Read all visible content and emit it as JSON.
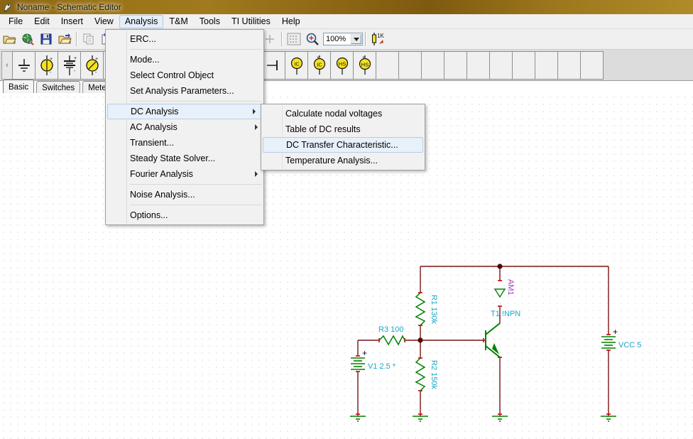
{
  "window": {
    "title": "Noname - Schematic Editor",
    "icon": "app-icon"
  },
  "menubar": {
    "items": [
      {
        "label": "File",
        "active": false
      },
      {
        "label": "Edit",
        "active": false
      },
      {
        "label": "Insert",
        "active": false
      },
      {
        "label": "View",
        "active": false
      },
      {
        "label": "Analysis",
        "active": true
      },
      {
        "label": "T&M",
        "active": false
      },
      {
        "label": "Tools",
        "active": false
      },
      {
        "label": "TI Utilities",
        "active": false
      },
      {
        "label": "Help",
        "active": false
      }
    ]
  },
  "toolbar": {
    "zoom_value": "100%",
    "buttons": [
      {
        "name": "open-button",
        "icon": "folder-open-icon"
      },
      {
        "name": "browse-button",
        "icon": "globe-search-icon"
      },
      {
        "name": "save-button",
        "icon": "floppy-save-icon"
      },
      {
        "name": "save-as-button",
        "icon": "folder-arrow-icon"
      },
      {
        "name": "copy-button",
        "icon": "copy-icon"
      },
      {
        "name": "paste-button",
        "icon": "paste-icon"
      },
      {
        "name": "cursor-button",
        "icon": "crosshair-icon"
      },
      {
        "name": "grid-button",
        "icon": "grid-icon"
      },
      {
        "name": "zoom-in-button",
        "icon": "magnifier-plus-icon"
      },
      {
        "name": "resistor-value-button",
        "icon": "resistor-1k-icon"
      }
    ]
  },
  "palette": {
    "scroll_left_label": "‹",
    "tabs": [
      {
        "label": "Basic",
        "selected": true
      },
      {
        "label": "Switches",
        "selected": false
      },
      {
        "label": "Meters",
        "selected": false
      }
    ],
    "cells": [
      {
        "name": "ground-symbol",
        "icon": "ground-icon"
      },
      {
        "name": "dc-source-symbol",
        "icon": "dc-source-icon"
      },
      {
        "name": "battery-symbol",
        "icon": "battery-icon"
      },
      {
        "name": "ac-source-symbol",
        "icon": "ac-source-icon"
      },
      {
        "name": "resistor-symbol",
        "icon": "resistor-icon"
      },
      {
        "name": "capacitor-symbol",
        "icon": "capacitor-icon"
      },
      {
        "name": "inductor-symbol",
        "icon": "inductor-icon"
      },
      {
        "name": "coupled-inductor-symbol",
        "icon": "coupled-inductor-icon"
      },
      {
        "name": "transformer-symbol",
        "icon": "transformer-icon"
      },
      {
        "name": "switch-symbol",
        "icon": "switch-icon"
      },
      {
        "name": "potentiometer-symbol",
        "icon": "potentiometer-icon"
      },
      {
        "name": "terminal-symbol",
        "icon": "terminal-icon"
      },
      {
        "name": "ic-symbol",
        "icon": "ic-icon"
      },
      {
        "name": "ic-plus-symbol",
        "icon": "ic-plus-icon"
      },
      {
        "name": "hs-symbol",
        "icon": "hs-icon"
      },
      {
        "name": "hs-plus-symbol",
        "icon": "hs-plus-icon"
      }
    ],
    "empty_cells": 10
  },
  "analysis_menu": {
    "items": [
      {
        "label": "ERC...",
        "submenu": false,
        "highlighted": false,
        "separator_after": true
      },
      {
        "label": "Mode...",
        "submenu": false,
        "highlighted": false,
        "separator_after": false
      },
      {
        "label": "Select Control Object",
        "submenu": false,
        "highlighted": false,
        "separator_after": false
      },
      {
        "label": "Set Analysis Parameters...",
        "submenu": false,
        "highlighted": false,
        "separator_after": true
      },
      {
        "label": "DC Analysis",
        "submenu": true,
        "highlighted": true,
        "separator_after": false
      },
      {
        "label": "AC Analysis",
        "submenu": true,
        "highlighted": false,
        "separator_after": false
      },
      {
        "label": "Transient...",
        "submenu": false,
        "highlighted": false,
        "separator_after": false
      },
      {
        "label": "Steady State Solver...",
        "submenu": false,
        "highlighted": false,
        "separator_after": false
      },
      {
        "label": "Fourier Analysis",
        "submenu": true,
        "highlighted": false,
        "separator_after": true
      },
      {
        "label": "Noise Analysis...",
        "submenu": false,
        "highlighted": false,
        "separator_after": true
      },
      {
        "label": "Options...",
        "submenu": false,
        "highlighted": false,
        "separator_after": false
      }
    ]
  },
  "dc_submenu": {
    "items": [
      {
        "label": "Calculate nodal voltages",
        "highlighted": false
      },
      {
        "label": "Table of DC results",
        "highlighted": false
      },
      {
        "label": "DC Transfer Characteristic...",
        "highlighted": true
      },
      {
        "label": "Temperature Analysis...",
        "highlighted": false
      }
    ]
  },
  "schematic": {
    "labels": {
      "r1": "R1 130k",
      "r2": "R2 150k",
      "r3": "R3 100",
      "v1": "V1 2.5 *",
      "vcc": "VCC 5",
      "transistor": "T1 !NPN",
      "ammeter": "AM1",
      "plus_v1": "+",
      "plus_vcc": "+"
    },
    "colors": {
      "wire": "#7a1414",
      "component": "#008000",
      "label": "#1aa7c4",
      "meter_label": "#9b3fb5",
      "node": "#4a0a0a",
      "pin": "#cc0000"
    }
  }
}
